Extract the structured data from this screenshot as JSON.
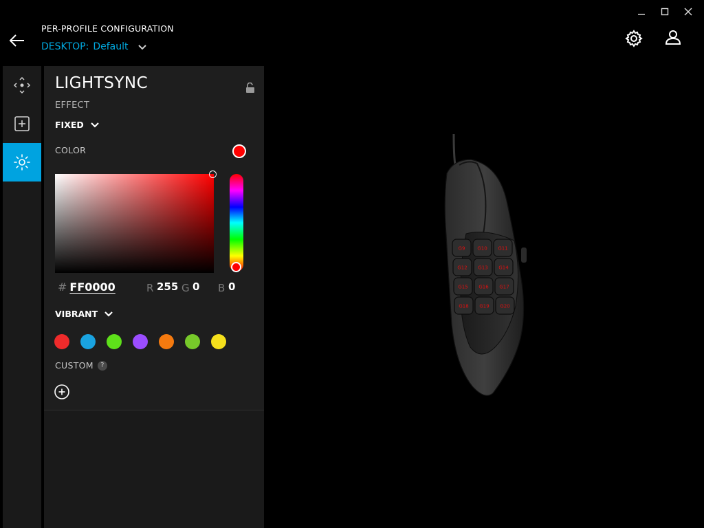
{
  "header": {
    "title": "PER-PROFILE CONFIGURATION",
    "profile_label": "DESKTOP:",
    "profile_name": "Default"
  },
  "panel": {
    "title": "LIGHTSYNC",
    "effect_label": "EFFECT",
    "effect_value": "FIXED",
    "color_label": "COLOR",
    "current_color": "#ff0000",
    "hex_prefix": "#",
    "hex_value": "FF0000",
    "r_label": "R",
    "r_value": "255",
    "g_label": "G",
    "g_value": "0",
    "b_label": "B",
    "b_value": "0",
    "palette_label": "VIBRANT",
    "presets": [
      "#ef2b2b",
      "#1aa3e0",
      "#5ee01a",
      "#9b4dff",
      "#f57a0f",
      "#77c92a",
      "#f5e01c"
    ],
    "custom_label": "CUSTOM",
    "help_glyph": "?"
  },
  "rail": {
    "items": [
      "pointer-settings-icon",
      "assignments-icon",
      "lightsync-icon"
    ],
    "active": "lightsync-icon"
  },
  "device": {
    "key_labels": [
      "G9",
      "G10",
      "G11",
      "G12",
      "G13",
      "G14",
      "G15",
      "G16",
      "G17",
      "G18",
      "G19",
      "G20"
    ],
    "accent_color": "#00a3e0"
  }
}
